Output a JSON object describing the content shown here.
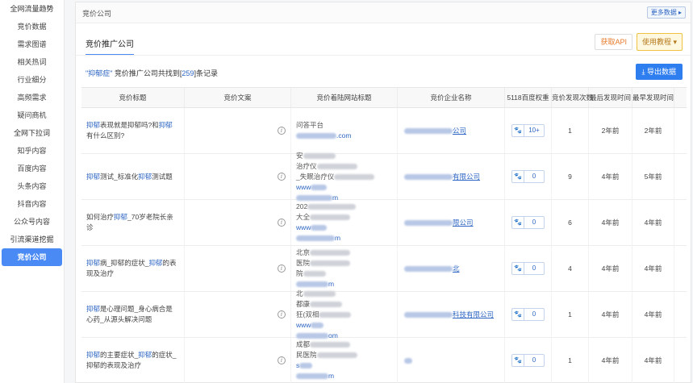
{
  "sidebar": {
    "items": [
      {
        "label": "全网流量趋势",
        "group": true
      },
      {
        "label": "竞价数据"
      },
      {
        "label": "需求图谱"
      },
      {
        "label": "相关热词"
      },
      {
        "label": "行业细分"
      },
      {
        "label": "高频需求"
      },
      {
        "label": "疑问商机"
      },
      {
        "label": "全网下拉词",
        "group": true
      },
      {
        "label": "知乎内容"
      },
      {
        "label": "百度内容"
      },
      {
        "label": "头条内容"
      },
      {
        "label": "抖音内容"
      },
      {
        "label": "公众号内容"
      },
      {
        "label": "引流渠道挖掘",
        "group": true
      },
      {
        "label": "竞价公司",
        "active": true
      }
    ]
  },
  "topbar": {
    "title": "竞价公司",
    "more_label": "更多数据 ▸"
  },
  "tabs": {
    "active_label": "竞价推广公司",
    "api_label": "获取API",
    "tutorial_label": "使用教程 ▾"
  },
  "summary": {
    "keyword": "\"抑郁症\"",
    "prefix": "竞价推广公司共找到[",
    "count": "259",
    "suffix": "]条记录",
    "export_label": "导出数据"
  },
  "table": {
    "headers": [
      "竞价标题",
      "竞价文案",
      "竞价着陆网站标题",
      "竞价企业名称",
      "5118百度权重",
      "竞价发现次数",
      "最后发现时间",
      "最早发现时间"
    ],
    "rows": [
      {
        "title_parts": [
          [
            "抑郁",
            1
          ],
          [
            "表现就是抑郁吗?和",
            0
          ],
          [
            "抑郁",
            1
          ],
          [
            "有什么区别?",
            0
          ]
        ],
        "landing": [
          "问答平台",
          ".com"
        ],
        "company": "公司",
        "weight": "10+",
        "count": "1",
        "last": "2年前",
        "first": "2年前"
      },
      {
        "title_parts": [
          [
            "抑郁",
            1
          ],
          [
            "测试_标准化",
            0
          ],
          [
            "抑郁",
            1
          ],
          [
            "测试题",
            0
          ]
        ],
        "landing": [
          "安",
          "治疗仪",
          "_失眠治疗仪",
          "www",
          "m"
        ],
        "company": "有限公司",
        "weight": "0",
        "count": "9",
        "last": "4年前",
        "first": "5年前"
      },
      {
        "title_parts": [
          [
            "如何治疗",
            0
          ],
          [
            "抑郁",
            1
          ],
          [
            "_70岁老院长亲诊",
            0
          ]
        ],
        "landing": [
          "202",
          "大全",
          "www",
          "m"
        ],
        "company": "限公司",
        "weight": "0",
        "count": "6",
        "last": "4年前",
        "first": "4年前"
      },
      {
        "title_parts": [
          [
            "抑郁",
            1
          ],
          [
            "病_抑郁的症状_",
            0
          ],
          [
            "抑郁",
            1
          ],
          [
            "的表现及治疗",
            0
          ]
        ],
        "landing": [
          "北京",
          "医院",
          "院",
          "m"
        ],
        "company": "北",
        "weight": "0",
        "count": "4",
        "last": "4年前",
        "first": "4年前"
      },
      {
        "title_parts": [
          [
            "抑郁",
            1
          ],
          [
            "是心理问题_身心病合是心药_从源头解决问题",
            0
          ]
        ],
        "landing": [
          "北",
          "都康",
          "狂(双相",
          "www",
          "om"
        ],
        "company": "科技有限公司",
        "weight": "0",
        "count": "1",
        "last": "4年前",
        "first": "4年前"
      },
      {
        "title_parts": [
          [
            "抑郁",
            1
          ],
          [
            "的主要症状_",
            0
          ],
          [
            "抑郁",
            1
          ],
          [
            "的症状_抑郁的表现及治疗",
            0
          ]
        ],
        "landing": [
          "成都",
          "民医院",
          "s",
          "m"
        ],
        "company": "",
        "weight": "0",
        "count": "1",
        "last": "4年前",
        "first": "4年前"
      }
    ]
  }
}
